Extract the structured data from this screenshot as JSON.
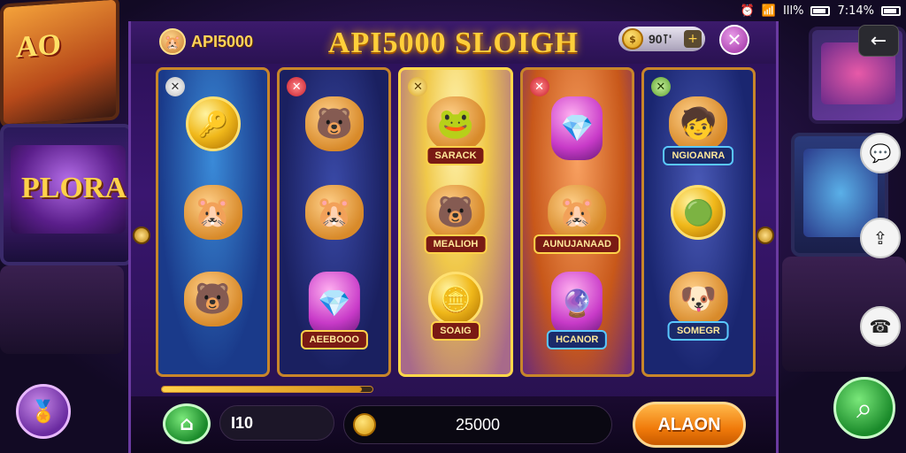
{
  "status": {
    "time": "7:14%",
    "signal_text": "Ill%"
  },
  "header": {
    "player_name": "API5000",
    "game_title": "API5000 SLOIGH",
    "coins": "90⊺'",
    "coin_add": "+",
    "close": "✕"
  },
  "reels": [
    {
      "marker": "✕",
      "symbols": [
        {
          "icon": "🔑",
          "tag": ""
        },
        {
          "icon": "🐹",
          "tag": ""
        },
        {
          "icon": "🐻",
          "tag": ""
        }
      ]
    },
    {
      "marker": "✕",
      "symbols": [
        {
          "icon": "🐻",
          "tag": ""
        },
        {
          "icon": "🐹",
          "tag": ""
        },
        {
          "icon": "💎",
          "tag": "AEEBOOO"
        }
      ]
    },
    {
      "marker": "✕",
      "symbols": [
        {
          "icon": "🐸",
          "tag": "SARACK"
        },
        {
          "icon": "🐻",
          "tag": "MEALIOH"
        },
        {
          "icon": "🪙",
          "tag": "SOAIG"
        }
      ]
    },
    {
      "marker": "✕",
      "symbols": [
        {
          "icon": "💎",
          "tag": ""
        },
        {
          "icon": "🐹",
          "tag": "AUNUJANAAD"
        },
        {
          "icon": "🔮",
          "tag": "HCANOR"
        }
      ]
    },
    {
      "marker": "✕",
      "symbols": [
        {
          "icon": "🧒",
          "tag": "NGIOANRA"
        },
        {
          "icon": "🟢",
          "tag": ""
        },
        {
          "icon": "🐶",
          "tag": "SOMEGR"
        }
      ]
    }
  ],
  "progress": 0.95,
  "controls": {
    "home_glyph": "⌂",
    "bet": "I10",
    "credits": "25000",
    "action_label": "ALAON"
  },
  "outer": {
    "back_glyph": "←",
    "search_glyph": "⌕"
  },
  "background": {
    "cab_left_top": "AO",
    "cab_left_mid": "PLORA"
  }
}
